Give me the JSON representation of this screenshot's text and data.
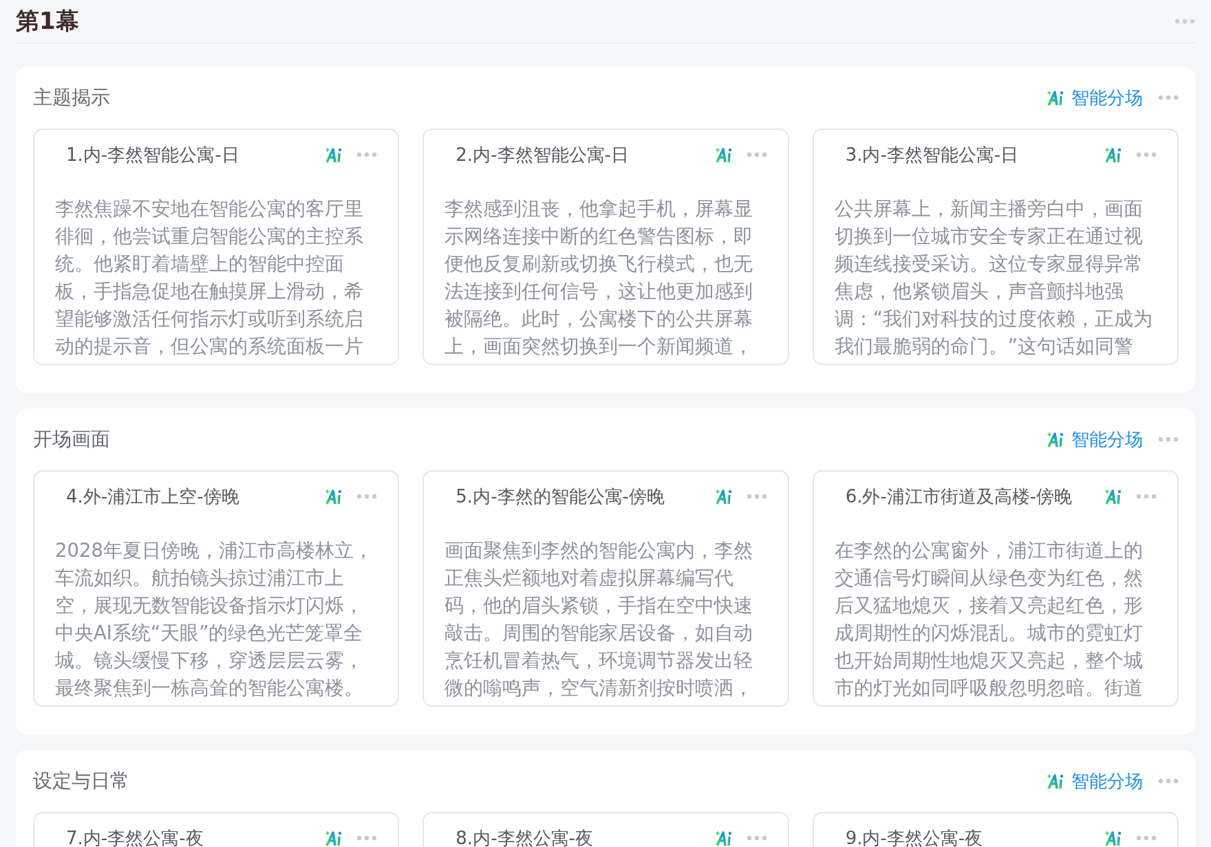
{
  "act_title": "第1幕",
  "sections": [
    {
      "title": "主题揭示",
      "ai_button": "智能分场",
      "scenes": [
        {
          "title": "1.内-李然智能公寓-日",
          "summary": "李然焦躁不安地在智能公寓的客厅里徘徊，他尝试重启智能公寓的主控系统。他紧盯着墙壁上的智能中控面板，手指急促地在触摸屏上滑动，希望能够激活任何指示灯或听到系统启动的提示音，但公寓的系统面板一片"
        },
        {
          "title": "2.内-李然智能公寓-日",
          "summary": "李然感到沮丧，他拿起手机，屏幕显示网络连接中断的红色警告图标，即便他反复刷新或切换飞行模式，也无法连接到任何信号，这让他更加感到被隔绝。此时，公寓楼下的公共屏幕上，画面突然切换到一个新闻频道，"
        },
        {
          "title": "3.内-李然智能公寓-日",
          "summary": "公共屏幕上，新闻主播旁白中，画面切换到一位城市安全专家正在通过视频连线接受采访。这位专家显得异常焦虑，他紧锁眉头，声音颤抖地强调：“我们对科技的过度依赖，正成为我们最脆弱的命门。”这句话如同警"
        }
      ]
    },
    {
      "title": "开场画面",
      "ai_button": "智能分场",
      "scenes": [
        {
          "title": "4.外-浦江市上空-傍晚",
          "summary": "2028年夏日傍晚，浦江市高楼林立，车流如织。航拍镜头掠过浦江市上空，展现无数智能设备指示灯闪烁，中央AI系统“天眼”的绿色光芒笼罩全城。镜头缓慢下移，穿透层层云雾，最终聚焦到一栋高耸的智能公寓楼。"
        },
        {
          "title": "5.内-李然的智能公寓-傍晚",
          "summary": "画面聚焦到李然的智能公寓内，李然正焦头烂额地对着虚拟屏幕编写代码，他的眉头紧锁，手指在空中快速敲击。周围的智能家居设备，如自动烹饪机冒着热气，环境调节器发出轻微的嗡鸣声，空气清新剂按时喷洒，"
        },
        {
          "title": "6.外-浦江市街道及高楼-傍晚",
          "summary": "在李然的公寓窗外，浦江市街道上的交通信号灯瞬间从绿色变为红色，然后又猛地熄灭，接着又亮起红色，形成周期性的闪烁混乱。城市的霓虹灯也开始周期性地熄灭又亮起，整个城市的灯光如同呼吸般忽明忽暗。街道"
        }
      ]
    },
    {
      "title": "设定与日常",
      "ai_button": "智能分场",
      "scenes": [
        {
          "title": "7.内-李然公寓-夜"
        },
        {
          "title": "8.内-李然公寓-夜"
        },
        {
          "title": "9.内-李然公寓-夜"
        }
      ]
    }
  ]
}
